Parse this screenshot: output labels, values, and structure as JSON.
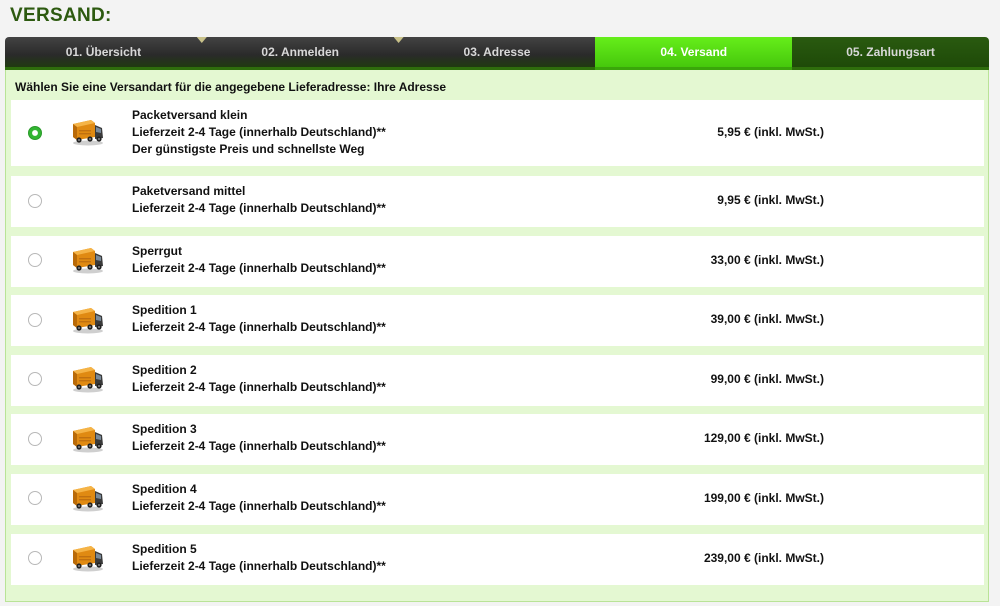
{
  "page": {
    "title": "VERSAND:"
  },
  "steps": [
    {
      "label": "01. Übersicht",
      "state": "done"
    },
    {
      "label": "02. Anmelden",
      "state": "done"
    },
    {
      "label": "03. Adresse",
      "state": "done"
    },
    {
      "label": "04. Versand",
      "state": "active"
    },
    {
      "label": "05. Zahlungsart",
      "state": "upcoming"
    }
  ],
  "colors": {
    "title": "#2d5a10",
    "active_step": "#58dd14",
    "panel_bg": "#e4f8d2"
  },
  "intro": "Wählen Sie eine Versandart für die angegebene Lieferadresse: Ihre Adresse",
  "options": [
    {
      "name": "Packetversand klein",
      "delivery": "Lieferzeit 2-4 Tage (innerhalb Deutschland)**",
      "note": "Der günstigste Preis und schnellste Weg",
      "price": "5,95 € (inkl. MwSt.)",
      "selected": true,
      "icon": "truck-icon"
    },
    {
      "name": "Paketversand mittel",
      "delivery": "Lieferzeit 2-4 Tage (innerhalb Deutschland)**",
      "price": "9,95 € (inkl. MwSt.)",
      "selected": false
    },
    {
      "name": "Sperrgut",
      "delivery": "Lieferzeit 2-4 Tage (innerhalb Deutschland)**",
      "price": "33,00 € (inkl. MwSt.)",
      "selected": false,
      "icon": "truck-icon"
    },
    {
      "name": "Spedition 1",
      "delivery": "Lieferzeit 2-4 Tage (innerhalb Deutschland)**",
      "price": "39,00 € (inkl. MwSt.)",
      "selected": false,
      "icon": "truck-icon"
    },
    {
      "name": "Spedition 2",
      "delivery": "Lieferzeit 2-4 Tage (innerhalb Deutschland)**",
      "price": "99,00 € (inkl. MwSt.)",
      "selected": false,
      "icon": "truck-icon"
    },
    {
      "name": "Spedition 3",
      "delivery": "Lieferzeit 2-4 Tage (innerhalb Deutschland)**",
      "price": "129,00 € (inkl. MwSt.)",
      "selected": false,
      "icon": "truck-icon"
    },
    {
      "name": "Spedition 4",
      "delivery": "Lieferzeit 2-4 Tage (innerhalb Deutschland)**",
      "price": "199,00 € (inkl. MwSt.)",
      "selected": false,
      "icon": "truck-icon"
    },
    {
      "name": "Spedition 5",
      "delivery": "Lieferzeit 2-4 Tage (innerhalb Deutschland)**",
      "price": "239,00 € (inkl. MwSt.)",
      "selected": false,
      "icon": "truck-icon"
    }
  ]
}
